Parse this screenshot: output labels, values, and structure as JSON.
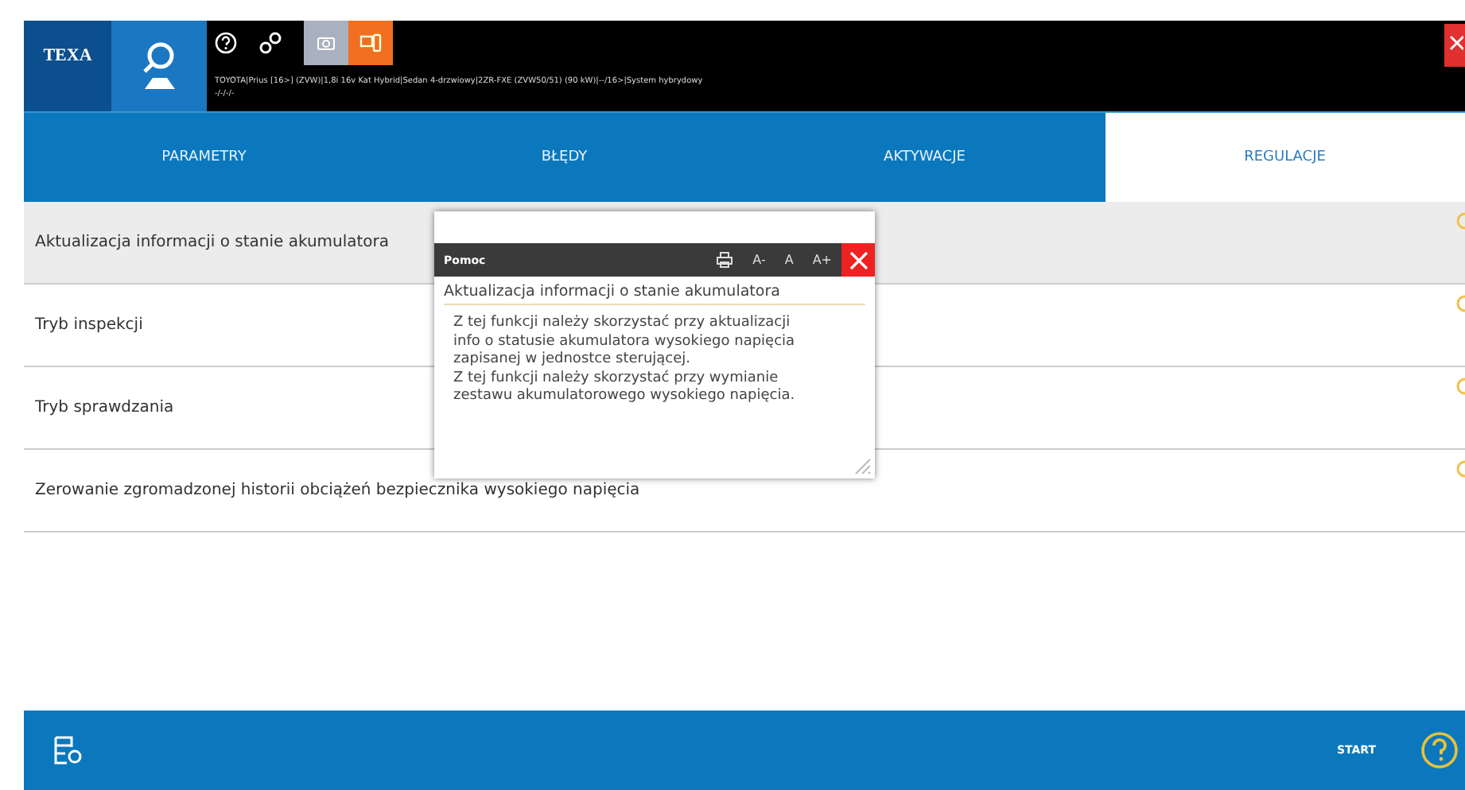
{
  "header": {
    "logo": "TEXA",
    "vehicle": "TOYOTA|Prius [16>] (ZVW)|1,8i 16v Kat Hybrid|Sedan 4-drzwiowy|2ZR-FXE (ZVW50/51) (90 kW)|--/16>|System hybrydowy",
    "vehicle_sub": "-/-/-/-"
  },
  "tabs": [
    {
      "label": "PARAMETRY",
      "selected": false
    },
    {
      "label": "BŁĘDY",
      "selected": false
    },
    {
      "label": "AKTYWACJE",
      "selected": false
    },
    {
      "label": "REGULACJE",
      "selected": true
    }
  ],
  "rows": [
    {
      "label": "Aktualizacja informacji o stanie akumulatora",
      "selected": true
    },
    {
      "label": "Tryb inspekcji",
      "selected": false
    },
    {
      "label": "Tryb sprawdzania",
      "selected": false
    },
    {
      "label": "Zerowanie zgromadzonej historii obciążeń bezpiecznika wysokiego napięcia",
      "selected": false
    }
  ],
  "help_popup": {
    "title": "Pomoc",
    "font_buttons": [
      "A-",
      "A",
      "A+"
    ],
    "heading": "Aktualizacja informacji o stanie akumulatora",
    "paragraphs": [
      "Z tej funkcji należy skorzystać przy aktualizacji info o statusie akumulatora wysokiego napięcia zapisanej w jednostce sterującej.",
      "Z tej funkcji należy skorzystać przy wymianie zestawu akumulatorowego wysokiego napięcia."
    ]
  },
  "footer": {
    "start": "START"
  }
}
